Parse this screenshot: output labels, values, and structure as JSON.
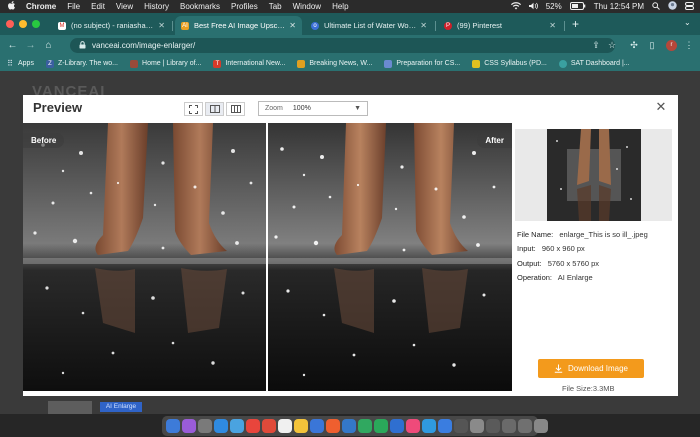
{
  "menubar": {
    "apple": "",
    "items": [
      "Chrome",
      "File",
      "Edit",
      "View",
      "History",
      "Bookmarks",
      "Profiles",
      "Tab",
      "Window",
      "Help"
    ],
    "battery": "52%",
    "clock": "Thu 12:54 PM"
  },
  "tabs": [
    {
      "title": "(no subject) - raniashahid09@...",
      "favicon": "M",
      "color": "#d93025"
    },
    {
      "title": "Best Free AI Image Upscaler |...",
      "favicon": "AI",
      "color": "#e8a020"
    },
    {
      "title": "Ultimate List of Water Words f...",
      "favicon": "o",
      "color": "#3b6fd6"
    },
    {
      "title": "(99) Pinterest",
      "favicon": "P",
      "color": "#d0202a"
    }
  ],
  "tab_new": "+",
  "address": {
    "url": "vanceai.com/image-enlarger/"
  },
  "bookmarks": [
    {
      "label": "Apps",
      "icon": "apps-grid-icon",
      "color": "#5b8def"
    },
    {
      "label": "Z-Library. The wo...",
      "icon": "z-library-icon",
      "color": "#3a5fa0"
    },
    {
      "label": "Home | Library of...",
      "icon": "library-icon",
      "color": "#9a4a3a"
    },
    {
      "label": "International New...",
      "icon": "news-icon",
      "color": "#d63a2a"
    },
    {
      "label": "Breaking News, W...",
      "icon": "news-icon",
      "color": "#e0a020"
    },
    {
      "label": "Preparation for CS...",
      "icon": "doc-icon",
      "color": "#6a8ad0"
    },
    {
      "label": "CSS Syllabus (PD...",
      "icon": "css-icon",
      "color": "#e0c020"
    },
    {
      "label": "SAT Dashboard |...",
      "icon": "sat-icon",
      "color": "#3aa0a0"
    }
  ],
  "page_bg": {
    "brand": "VANCEAI",
    "badge": "AI Enlarge"
  },
  "modal": {
    "title": "Preview",
    "zoom_label": "Zoom",
    "zoom_value": "100%",
    "before_label": "Before",
    "after_label": "After",
    "info": {
      "file_name_key": "File Name:",
      "file_name": "enlarge_This is so ill_.jpeg",
      "input_key": "Input:",
      "input": "960 x 960 px",
      "output_key": "Output:",
      "output": "5760 x 5760 px",
      "operation_key": "Operation:",
      "operation": "AI Enlarge"
    },
    "download_label": "Download Image",
    "file_size": "File Size:3.3MB"
  },
  "dock_colors": [
    "#3d7bd9",
    "#9a5cd8",
    "#7a7a7a",
    "#2f8ae0",
    "#4aa3e0",
    "#e8453c",
    "#e04a3a",
    "#f0f0f0",
    "#f3c33a",
    "#3a76d8",
    "#ef5f2f",
    "#3478c8",
    "#30a860",
    "#2aa85a",
    "#2f6fd0",
    "#ef4a7a",
    "#2f9ae0",
    "#3a7de0",
    "#555555",
    "#8a8a8a",
    "#5a5a5a",
    "#6a6a6a",
    "#707070",
    "#888888"
  ],
  "colors": {
    "tab_strip": "#1e5a5a",
    "toolbar": "#2a7070",
    "download": "#f39a1c"
  }
}
